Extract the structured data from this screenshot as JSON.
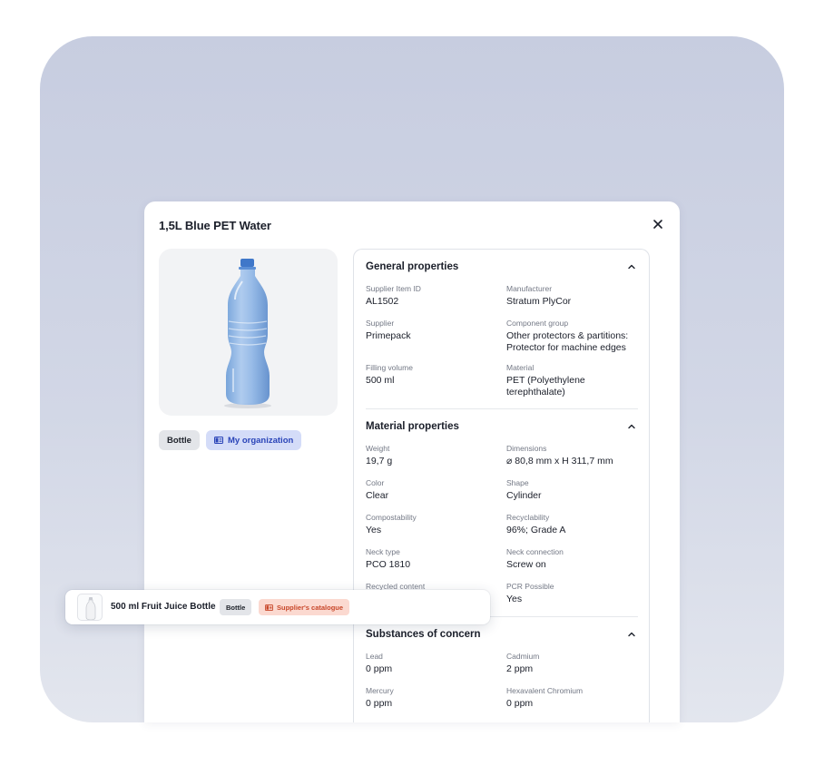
{
  "modal": {
    "title": "1,5L Blue PET Water",
    "tags": {
      "type": "Bottle",
      "owner": "My organization"
    }
  },
  "sections": {
    "general": {
      "title": "General properties",
      "props": [
        {
          "label": "Supplier Item ID",
          "value": "AL1502"
        },
        {
          "label": "Manufacturer",
          "value": "Stratum PlyCor"
        },
        {
          "label": "Supplier",
          "value": "Primepack"
        },
        {
          "label": "Component group",
          "value": "Other protectors & partitions: Protector for machine edges"
        },
        {
          "label": "Filling volume",
          "value": "500 ml"
        },
        {
          "label": "Material",
          "value": "PET (Polyethylene terephthalate)"
        }
      ]
    },
    "material": {
      "title": "Material properties",
      "props": [
        {
          "label": "Weight",
          "value": "19,7 g"
        },
        {
          "label": "Dimensions",
          "value": "⌀ 80,8 mm x H 311,7 mm"
        },
        {
          "label": "Color",
          "value": "Clear"
        },
        {
          "label": "Shape",
          "value": "Cylinder"
        },
        {
          "label": "Compostability",
          "value": "Yes"
        },
        {
          "label": "Recyclability",
          "value": "96%; Grade A"
        },
        {
          "label": "Neck type",
          "value": "PCO 1810"
        },
        {
          "label": "Neck connection",
          "value": "Screw on"
        },
        {
          "label": "Recycled content",
          "value": ""
        },
        {
          "label": "PCR Possible",
          "value": "Yes"
        }
      ]
    },
    "substances": {
      "title": "Substances of concern",
      "props": [
        {
          "label": "Lead",
          "value": "0 ppm"
        },
        {
          "label": "Cadmium",
          "value": "2 ppm"
        },
        {
          "label": "Mercury",
          "value": "0 ppm"
        },
        {
          "label": "Hexavalent Chromium",
          "value": "0 ppm"
        }
      ]
    }
  },
  "floating_item": {
    "title": "500 ml Fruit Juice Bottle",
    "tags": {
      "type": "Bottle",
      "source": "Supplier's catalogue"
    }
  },
  "icons": {
    "close": "close-icon",
    "chevron": "chevron-up-icon",
    "org": "catalog-icon",
    "catalogue": "catalog-icon"
  },
  "colors": {
    "accent_blue": "#2a44b8",
    "accent_blue_bg": "#d4dcf8",
    "accent_red": "#c8472a",
    "accent_red_bg": "#fbd9d0"
  }
}
